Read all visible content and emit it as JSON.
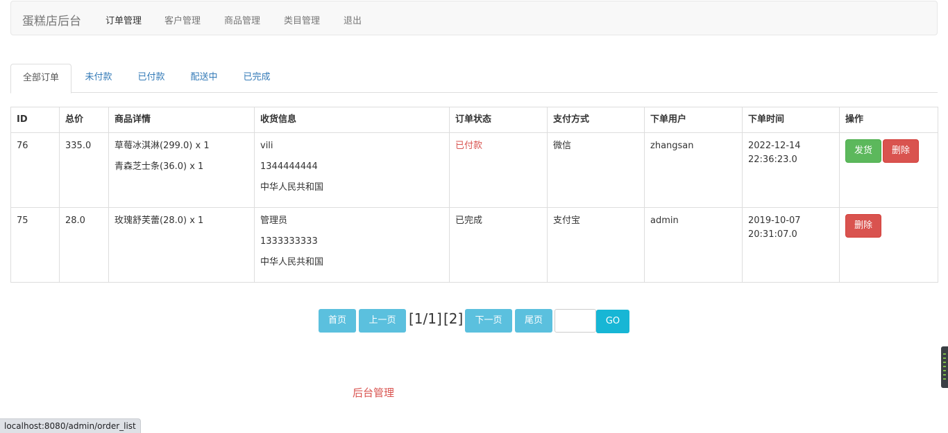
{
  "nav": {
    "brand": "蛋糕店后台",
    "items": [
      {
        "label": "订单管理",
        "active": true
      },
      {
        "label": "客户管理"
      },
      {
        "label": "商品管理"
      },
      {
        "label": "类目管理"
      },
      {
        "label": "退出"
      }
    ]
  },
  "tabs": [
    {
      "label": "全部订单",
      "active": true
    },
    {
      "label": "未付款"
    },
    {
      "label": "已付款"
    },
    {
      "label": "配送中"
    },
    {
      "label": "已完成"
    }
  ],
  "table": {
    "headers": [
      "ID",
      "总价",
      "商品详情",
      "收货信息",
      "订单状态",
      "支付方式",
      "下单用户",
      "下单时间",
      "操作"
    ],
    "rows": [
      {
        "id": "76",
        "total": "335.0",
        "items": [
          "草莓冰淇淋(299.0) x 1",
          "青森芝士条(36.0) x 1"
        ],
        "shipping": [
          "vili",
          "1344444444",
          "中华人民共和国"
        ],
        "status": "已付款",
        "payment": "微信",
        "user": "zhangsan",
        "time_date": "2022-12-14",
        "time_clock": "22:36:23.0",
        "ship_label": "发货",
        "delete_label": "删除"
      },
      {
        "id": "75",
        "total": "28.0",
        "items": [
          "玫瑰舒芙蕾(28.0) x 1"
        ],
        "shipping": [
          "管理员",
          "1333333333",
          "中华人民共和国"
        ],
        "status": "已完成",
        "payment": "支付宝",
        "user": "admin",
        "time_date": "2019-10-07",
        "time_clock": "20:31:07.0",
        "delete_label": "删除"
      }
    ]
  },
  "pager": {
    "first": "首页",
    "prev": "上一页",
    "info": "[1/1]",
    "total": "[2]",
    "next": "下一页",
    "last": "尾页",
    "input_value": "",
    "go": "GO"
  },
  "footer": "后台管理",
  "status_bar_url": "localhost:8080/admin/order_list"
}
